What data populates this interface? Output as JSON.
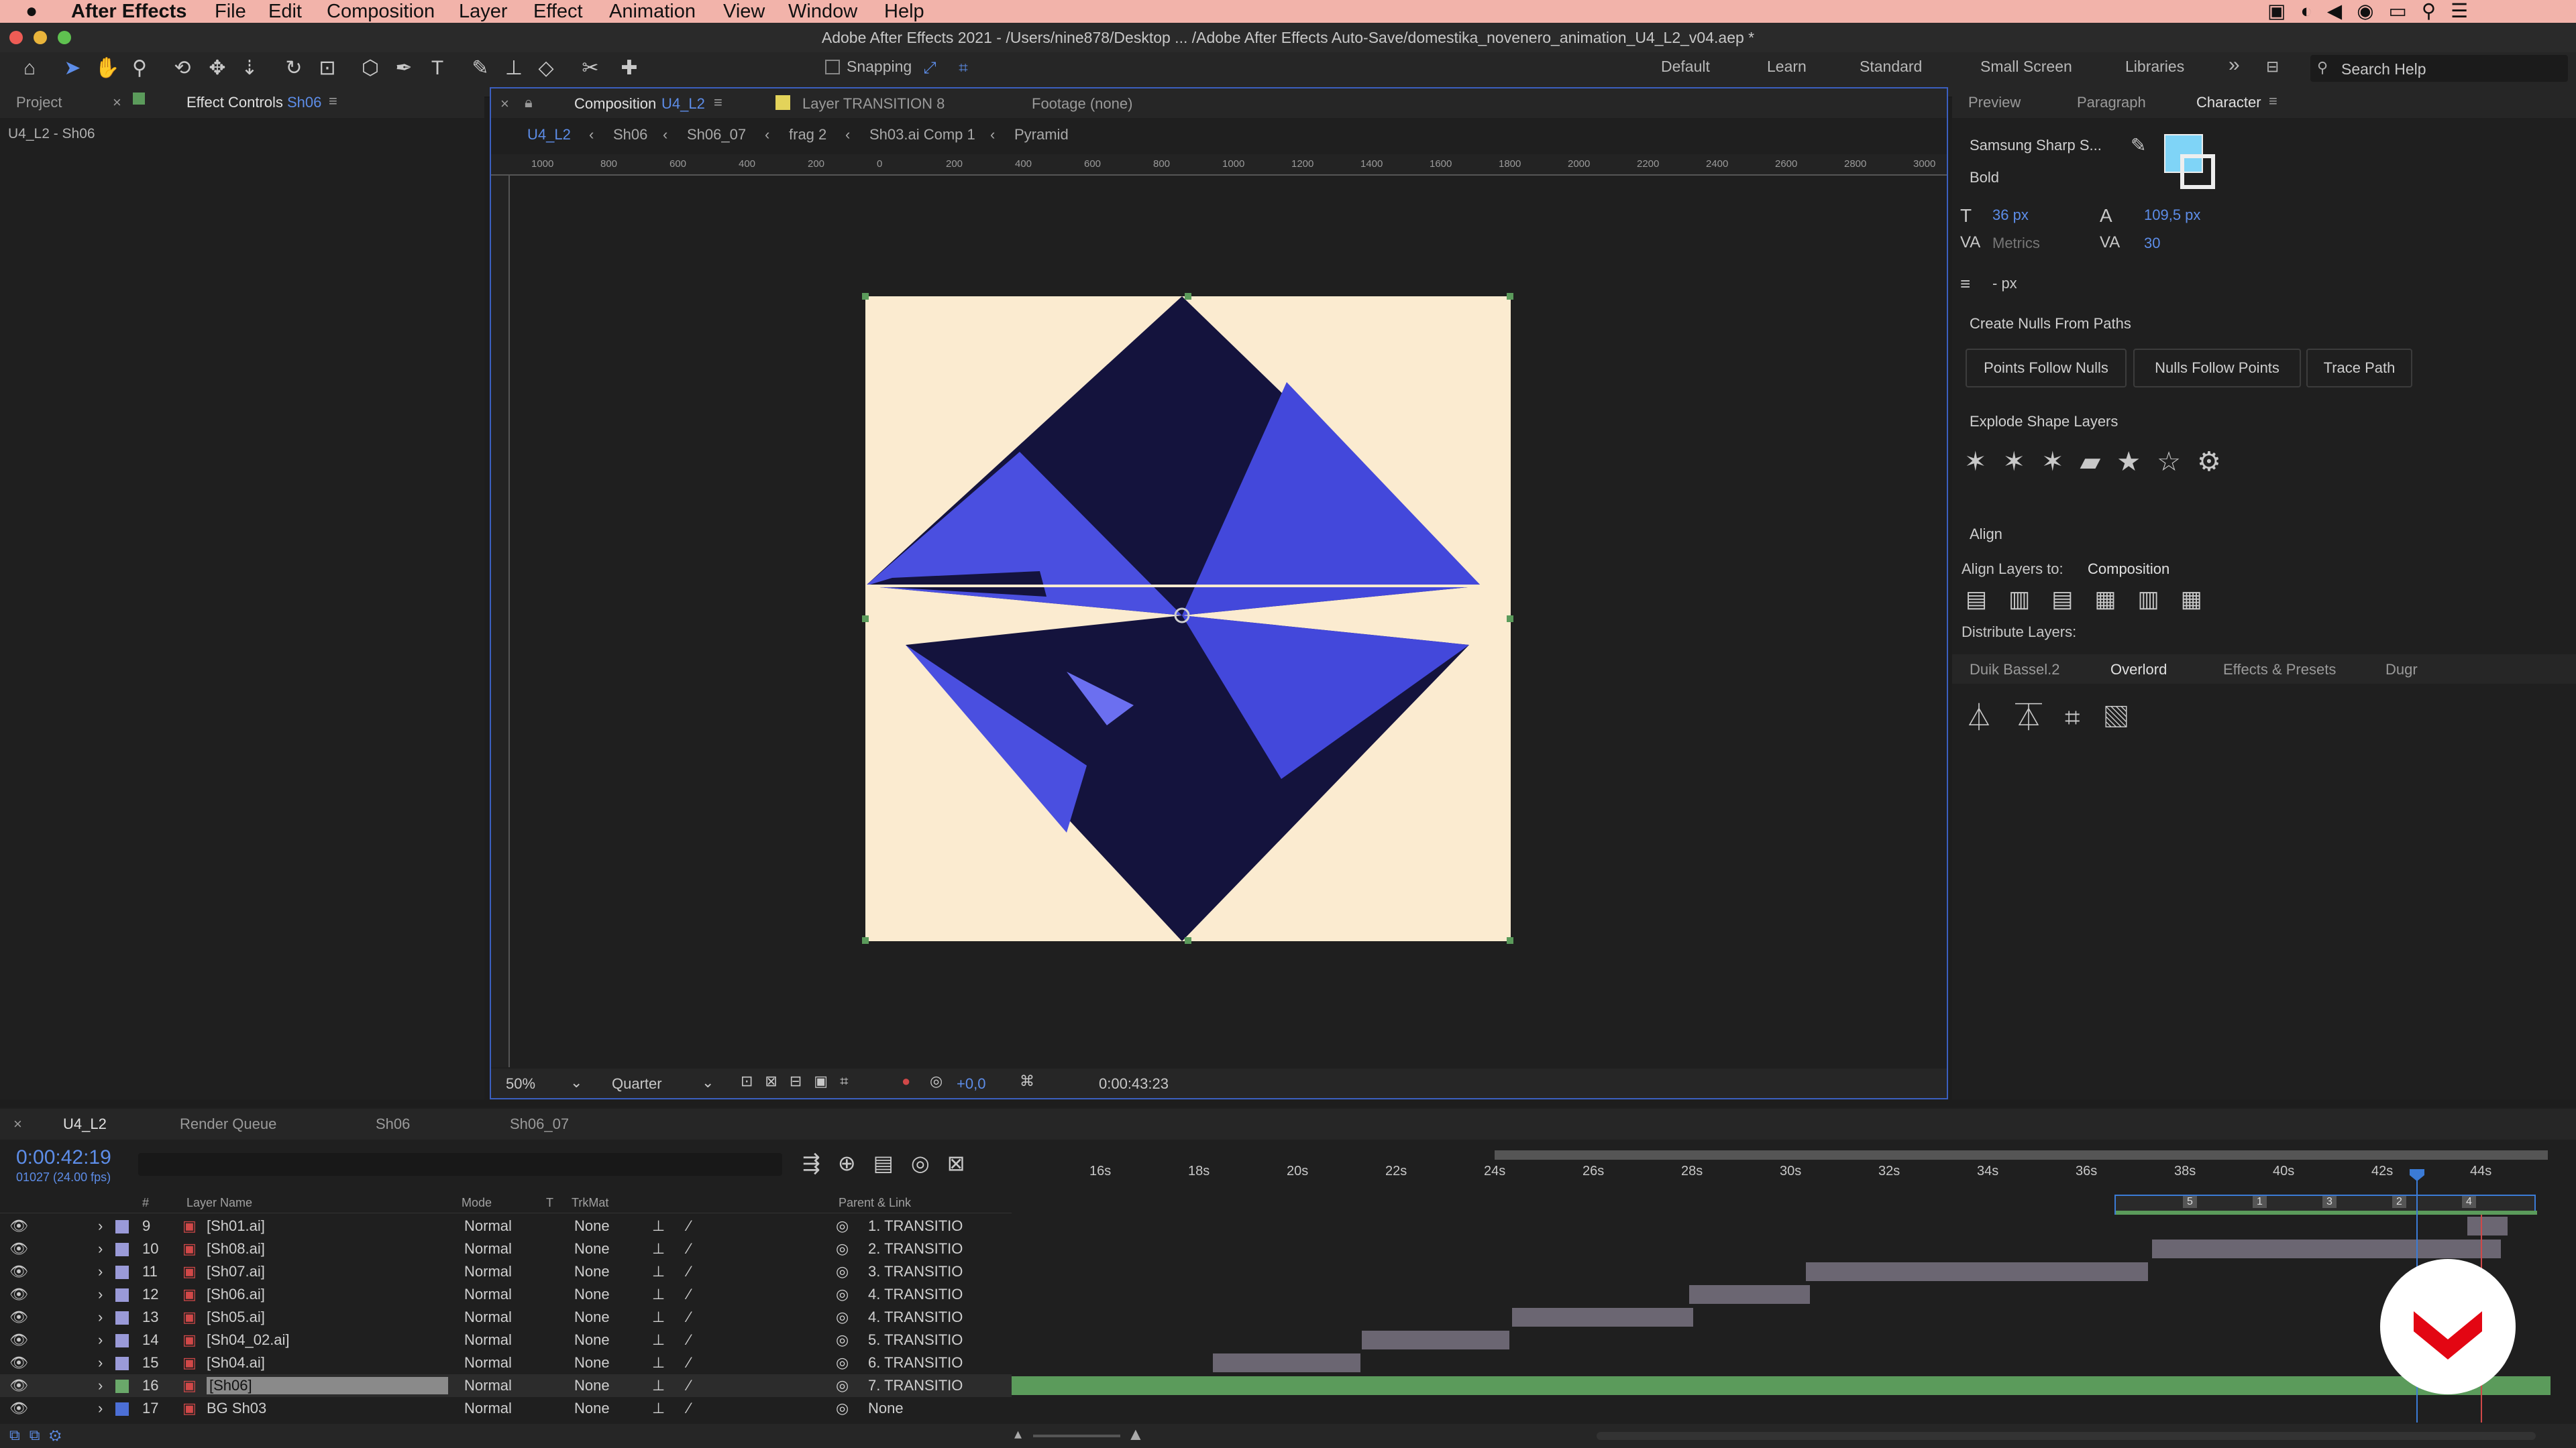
{
  "menu": {
    "app": "After Effects",
    "items": [
      "File",
      "Edit",
      "Composition",
      "Layer",
      "Effect",
      "Animation",
      "View",
      "Window",
      "Help"
    ]
  },
  "title": "Adobe After Effects 2021 - /Users/nine878/Desktop ... /Adobe After Effects Auto-Save/domestika_novenero_animation_U4_L2_v04.aep *",
  "toolbar": {
    "snapping": "Snapping",
    "workspaces": [
      "Default",
      "Learn",
      "Standard",
      "Small Screen",
      "Libraries"
    ],
    "search_placeholder": "Search Help"
  },
  "left_panel": {
    "tab_project": "Project",
    "tab_effect": "Effect Controls",
    "tab_effect_layer": "Sh06",
    "subtitle": "U4_L2 - Sh06"
  },
  "comp_panel": {
    "tab_comp": "Composition",
    "tab_comp_name": "U4_L2",
    "tab_layer": "Layer TRANSITION 8",
    "tab_footage": "Footage (none)",
    "breadcrumbs": [
      "U4_L2",
      "Sh06",
      "Sh06_07",
      "frag 2",
      "Sh03.ai Comp 1",
      "Pyramid"
    ],
    "ruler_top": [
      "1000",
      "800",
      "600",
      "400",
      "200",
      "0",
      "200",
      "400",
      "600",
      "800",
      "1000",
      "1200",
      "1400",
      "1600",
      "1800",
      "2000",
      "2200",
      "2400",
      "2600",
      "2800",
      "3000"
    ],
    "zoom": "50%",
    "resolution": "Quarter",
    "exposure": "+0,0",
    "timecode": "0:00:43:23"
  },
  "right_panel": {
    "tabs": [
      "Preview",
      "Paragraph",
      "Character"
    ],
    "font": "Samsung Sharp S...",
    "style": "Bold",
    "size": "36 px",
    "leading": "109,5 px",
    "kerning": "Metrics",
    "tracking": "30",
    "stroke": "- px",
    "fill_color": "#7fd4f7",
    "nulls_title": "Create Nulls From Paths",
    "nulls_buttons": [
      "Points Follow Nulls",
      "Nulls Follow Points",
      "Trace Path"
    ],
    "explode_title": "Explode Shape Layers",
    "align_title": "Align",
    "align_to_label": "Align Layers to:",
    "align_to_value": "Composition",
    "distribute_label": "Distribute Layers:",
    "bottom_tabs": [
      "Duik Bassel.2",
      "Overlord",
      "Effects & Presets",
      "Dugr"
    ]
  },
  "timeline": {
    "tabs": [
      "U4_L2",
      "Render Queue",
      "Sh06",
      "Sh06_07"
    ],
    "current_time": "0:00:42:19",
    "frames": "01027 (24.00 fps)",
    "columns": [
      "#",
      "Layer Name",
      "Mode",
      "T",
      "TrkMat",
      "Parent & Link"
    ],
    "ticks": [
      "16s",
      "18s",
      "20s",
      "22s",
      "24s",
      "26s",
      "28s",
      "30s",
      "32s",
      "34s",
      "36s",
      "38s",
      "40s",
      "42s",
      "44s"
    ],
    "markers": [
      "5",
      "1",
      "3",
      "2",
      "4"
    ],
    "layers": [
      {
        "num": "9",
        "name": "[Sh01.ai]",
        "mode": "Normal",
        "trk": "None",
        "parent": "1. TRANSITIO",
        "color": "#9a9ad8",
        "bar": [
          0,
          0
        ]
      },
      {
        "num": "10",
        "name": "[Sh08.ai]",
        "mode": "Normal",
        "trk": "None",
        "parent": "2. TRANSITIO",
        "color": "#9a9ad8",
        "bar": [
          0,
          0
        ]
      },
      {
        "num": "11",
        "name": "[Sh07.ai]",
        "mode": "Normal",
        "trk": "None",
        "parent": "3. TRANSITIO",
        "color": "#9a9ad8",
        "bar": [
          0,
          0
        ]
      },
      {
        "num": "12",
        "name": "[Sh06.ai]",
        "mode": "Normal",
        "trk": "None",
        "parent": "4. TRANSITIO",
        "color": "#9a9ad8",
        "bar": [
          0,
          0
        ]
      },
      {
        "num": "13",
        "name": "[Sh05.ai]",
        "mode": "Normal",
        "trk": "None",
        "parent": "4. TRANSITIO",
        "color": "#9a9ad8",
        "bar": [
          0,
          0
        ]
      },
      {
        "num": "14",
        "name": "[Sh04_02.ai]",
        "mode": "Normal",
        "trk": "None",
        "parent": "5. TRANSITIO",
        "color": "#9a9ad8",
        "bar": [
          0,
          0
        ]
      },
      {
        "num": "15",
        "name": "[Sh04.ai]",
        "mode": "Normal",
        "trk": "None",
        "parent": "6. TRANSITIO",
        "color": "#9a9ad8",
        "bar": [
          0,
          0
        ]
      },
      {
        "num": "16",
        "name": "[Sh06]",
        "mode": "Normal",
        "trk": "None",
        "parent": "7. TRANSITIO",
        "color": "#6aa86a",
        "bar": [
          0,
          0
        ]
      },
      {
        "num": "17",
        "name": "BG Sh03",
        "mode": "Normal",
        "trk": "None",
        "parent": "None",
        "color": "#4c6fd6",
        "bar": [
          0,
          0
        ]
      }
    ]
  }
}
